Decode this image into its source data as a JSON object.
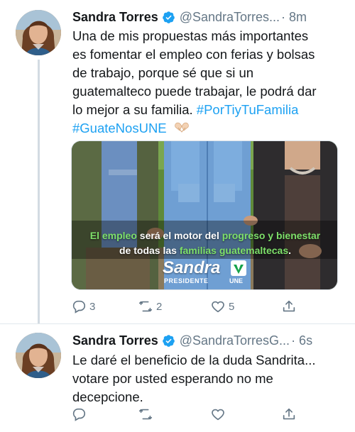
{
  "colors": {
    "link": "#1da1f2",
    "text": "#14171a",
    "secondary": "#657786",
    "verified": "#1da1f2",
    "une_green": "#16a34a"
  },
  "tweets": [
    {
      "name": "Sandra Torres",
      "handle": "@SandraTorres...",
      "time": "· 8m",
      "text_lines": [
        "Una de mis propuestas más importantes",
        "es fomentar el empleo con ferias y bolsas",
        "de trabajo, porque sé que si un",
        "guatemalteco puede trabajar, le podrá dar"
      ],
      "text_line5": "lo mejor a su familia.",
      "hashtag1": "#PorTiyTuFamilia",
      "hashtag2": "#GuateNosUNE",
      "emoji_icon": "heart-hands-icon",
      "media": {
        "caption_1a": "El empleo",
        "caption_1b": " será el motor del ",
        "caption_1c": "progreso y bienestar",
        "caption_2a": "de todas las ",
        "caption_2b": "familias guatemaltecas",
        "caption_2c": ".",
        "logo_text": "Sandra",
        "logo_sub": "PRESIDENTE",
        "logo_party": "UNE"
      },
      "actions": {
        "reply_count": "3",
        "retweet_count": "2",
        "like_count": "5"
      }
    },
    {
      "name": "Sandra Torres",
      "handle": "@SandraTorresG...",
      "time": "· 6s",
      "text_lines": [
        "Le daré el beneficio de la duda Sandrita...",
        "votare por usted esperando no me",
        "decepcione."
      ],
      "actions": {
        "reply_count": "",
        "retweet_count": "",
        "like_count": ""
      }
    }
  ]
}
